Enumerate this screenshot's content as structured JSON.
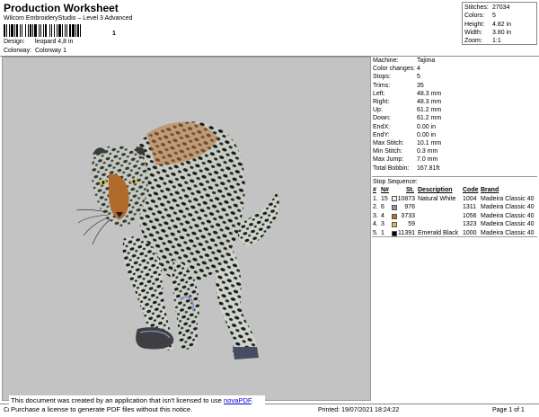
{
  "header": {
    "title": "Production Worksheet",
    "subtitle": "Wilcom EmbroideryStudio – Level 3 Advanced",
    "barcode_suffix": "1",
    "design_label": "Design:",
    "design_value": "leopard 4,8 in",
    "colorway_label": "Colorway:",
    "colorway_value": "Colorway 1"
  },
  "stats": [
    {
      "label": "Stitches:",
      "value": "27034"
    },
    {
      "label": "Colors:",
      "value": "5"
    },
    {
      "label": "Height:",
      "value": "4.82 in"
    },
    {
      "label": "Width:",
      "value": "3.80 in"
    },
    {
      "label": "Zoom:",
      "value": "1:1"
    }
  ],
  "machine": [
    {
      "label": "Machine:",
      "value": "Tajima"
    },
    {
      "label": "Color changes:",
      "value": "4"
    },
    {
      "label": "Stops:",
      "value": "5"
    },
    {
      "label": "Trims:",
      "value": "35"
    },
    {
      "label": "Left:",
      "value": "48.3 mm"
    },
    {
      "label": "Right:",
      "value": "48.3 mm"
    },
    {
      "label": "Up:",
      "value": "61.2 mm"
    },
    {
      "label": "Down:",
      "value": "61.2 mm"
    },
    {
      "label": "EndX:",
      "value": "0.00 in"
    },
    {
      "label": "EndY:",
      "value": "0.00 in"
    },
    {
      "label": "Max Stitch:",
      "value": "10.1 mm"
    },
    {
      "label": "Min Stitch:",
      "value": "0.3 mm"
    },
    {
      "label": "Max Jump:",
      "value": "7.0 mm"
    },
    {
      "label": "Total Bobbin:",
      "value": "167.81ft"
    }
  ],
  "stop_sequence": {
    "heading": "Stop Sequence:",
    "columns": [
      "#",
      "N#",
      "St.",
      "Description",
      "Code",
      "Brand"
    ],
    "rows": [
      {
        "idx": "1.",
        "n": "15",
        "color": "#efefef",
        "st": "10873",
        "desc": "Natural White",
        "code": "1004",
        "brand": "Madeira Classic 40"
      },
      {
        "idx": "2.",
        "n": "6",
        "color": "#8a94c4",
        "st": "976",
        "desc": "",
        "code": "1311",
        "brand": "Madeira Classic 40"
      },
      {
        "idx": "3.",
        "n": "4",
        "color": "#b7702e",
        "st": "3733",
        "desc": "",
        "code": "1056",
        "brand": "Madeira Classic 40"
      },
      {
        "idx": "4.",
        "n": "3",
        "color": "#e2b84d",
        "st": "59",
        "desc": "",
        "code": "1323",
        "brand": "Madeira Classic 40"
      },
      {
        "idx": "5.",
        "n": "1",
        "color": "#000000",
        "st": "11391",
        "desc": "Emerald Black",
        "code": "1000",
        "brand": "Madeira Classic 40"
      }
    ]
  },
  "footer": {
    "notice_line1": "This document was created by an application that isn't licensed to use",
    "notice_link": "novaPDF",
    "notice_line2": "Purchase a license to generate PDF files without this notice.",
    "cr": "Cr",
    "printed": "Printed: 19/07/2021 18:24:22",
    "page": "Page 1 of 1"
  }
}
